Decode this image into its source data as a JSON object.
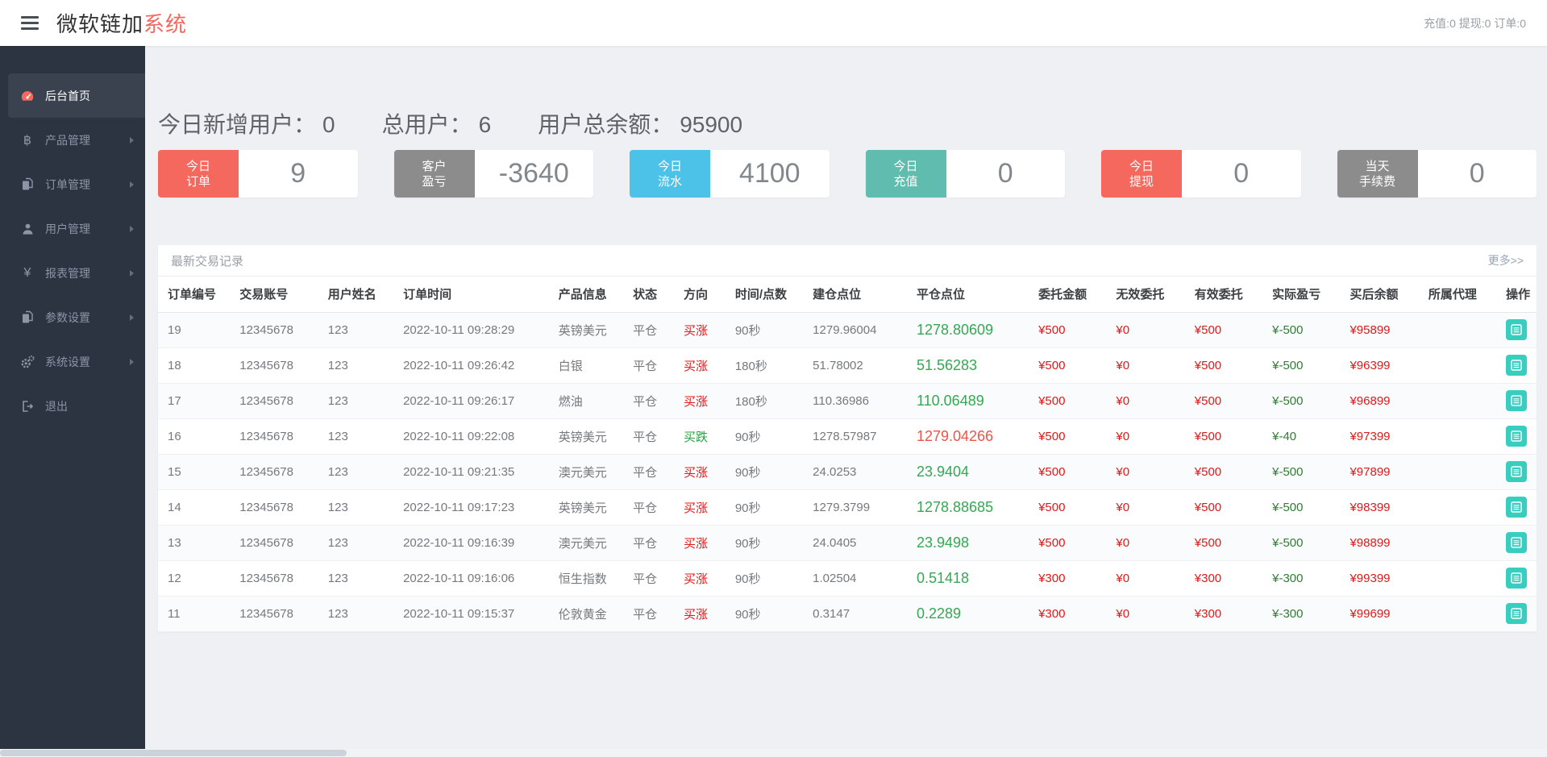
{
  "header": {
    "title_black": "微软链加",
    "title_red": "系统",
    "right_stats": "充值:0 提现:0 订单:0"
  },
  "sidebar": {
    "items": [
      {
        "key": "home",
        "label": "后台首页",
        "icon": "dashboard-icon",
        "active": true,
        "arrow": false
      },
      {
        "key": "product",
        "label": "产品管理",
        "icon": "bitcoin-icon",
        "active": false,
        "arrow": true
      },
      {
        "key": "order",
        "label": "订单管理",
        "icon": "files-icon",
        "active": false,
        "arrow": true
      },
      {
        "key": "user",
        "label": "用户管理",
        "icon": "user-icon",
        "active": false,
        "arrow": true
      },
      {
        "key": "report",
        "label": "报表管理",
        "icon": "yen-icon",
        "active": false,
        "arrow": true
      },
      {
        "key": "params",
        "label": "参数设置",
        "icon": "files-icon",
        "active": false,
        "arrow": true
      },
      {
        "key": "system",
        "label": "系统设置",
        "icon": "gears-icon",
        "active": false,
        "arrow": true
      },
      {
        "key": "logout",
        "label": "退出",
        "icon": "logout-icon",
        "active": false,
        "arrow": false
      }
    ]
  },
  "summary": {
    "items": [
      {
        "label": "今日新增用户：",
        "value": "0"
      },
      {
        "label": "总用户：",
        "value": "6"
      },
      {
        "label": "用户总余额：",
        "value": "95900"
      }
    ]
  },
  "stat_cards": [
    {
      "label_lines": [
        "今日",
        "订单"
      ],
      "value": "9",
      "color": "#f4685e"
    },
    {
      "label_lines": [
        "客户",
        "盈亏"
      ],
      "value": "-3640",
      "color": "#8c8c8c"
    },
    {
      "label_lines": [
        "今日",
        "流水"
      ],
      "value": "4100",
      "color": "#4dc2e9"
    },
    {
      "label_lines": [
        "今日",
        "充值"
      ],
      "value": "0",
      "color": "#5fbcae"
    },
    {
      "label_lines": [
        "今日",
        "提现"
      ],
      "value": "0",
      "color": "#f4685e"
    },
    {
      "label_lines": [
        "当天",
        "手续费"
      ],
      "value": "0",
      "color": "#8c8c8c"
    }
  ],
  "panel": {
    "title": "最新交易记录",
    "more_link": "更多>>",
    "columns": [
      "订单编号",
      "交易账号",
      "用户姓名",
      "订单时间",
      "产品信息",
      "状态",
      "方向",
      "时间/点数",
      "建仓点位",
      "平仓点位",
      "委托金额",
      "无效委托",
      "有效委托",
      "实际盈亏",
      "买后余额",
      "所属代理",
      "操作"
    ],
    "rows": [
      {
        "id": "19",
        "account": "12345678",
        "name": "123",
        "time": "2022-10-11 09:28:29",
        "product": "英镑美元",
        "status": "平仓",
        "direction": "买涨",
        "dir_color": "red",
        "duration": "90秒",
        "open": "1279.96004",
        "close": "1278.80609",
        "close_color": "green",
        "amount": "¥500",
        "invalid": "¥0",
        "valid": "¥500",
        "profit": "¥-500",
        "balance": "¥95899",
        "agent": ""
      },
      {
        "id": "18",
        "account": "12345678",
        "name": "123",
        "time": "2022-10-11 09:26:42",
        "product": "白银",
        "status": "平仓",
        "direction": "买涨",
        "dir_color": "red",
        "duration": "180秒",
        "open": "51.78002",
        "close": "51.56283",
        "close_color": "green",
        "amount": "¥500",
        "invalid": "¥0",
        "valid": "¥500",
        "profit": "¥-500",
        "balance": "¥96399",
        "agent": ""
      },
      {
        "id": "17",
        "account": "12345678",
        "name": "123",
        "time": "2022-10-11 09:26:17",
        "product": "燃油",
        "status": "平仓",
        "direction": "买涨",
        "dir_color": "red",
        "duration": "180秒",
        "open": "110.36986",
        "close": "110.06489",
        "close_color": "green",
        "amount": "¥500",
        "invalid": "¥0",
        "valid": "¥500",
        "profit": "¥-500",
        "balance": "¥96899",
        "agent": ""
      },
      {
        "id": "16",
        "account": "12345678",
        "name": "123",
        "time": "2022-10-11 09:22:08",
        "product": "英镑美元",
        "status": "平仓",
        "direction": "买跌",
        "dir_color": "green",
        "duration": "90秒",
        "open": "1278.57987",
        "close": "1279.04266",
        "close_color": "red",
        "amount": "¥500",
        "invalid": "¥0",
        "valid": "¥500",
        "profit": "¥-40",
        "balance": "¥97399",
        "agent": ""
      },
      {
        "id": "15",
        "account": "12345678",
        "name": "123",
        "time": "2022-10-11 09:21:35",
        "product": "澳元美元",
        "status": "平仓",
        "direction": "买涨",
        "dir_color": "red",
        "duration": "90秒",
        "open": "24.0253",
        "close": "23.9404",
        "close_color": "green",
        "amount": "¥500",
        "invalid": "¥0",
        "valid": "¥500",
        "profit": "¥-500",
        "balance": "¥97899",
        "agent": ""
      },
      {
        "id": "14",
        "account": "12345678",
        "name": "123",
        "time": "2022-10-11 09:17:23",
        "product": "英镑美元",
        "status": "平仓",
        "direction": "买涨",
        "dir_color": "red",
        "duration": "90秒",
        "open": "1279.3799",
        "close": "1278.88685",
        "close_color": "green",
        "amount": "¥500",
        "invalid": "¥0",
        "valid": "¥500",
        "profit": "¥-500",
        "balance": "¥98399",
        "agent": ""
      },
      {
        "id": "13",
        "account": "12345678",
        "name": "123",
        "time": "2022-10-11 09:16:39",
        "product": "澳元美元",
        "status": "平仓",
        "direction": "买涨",
        "dir_color": "red",
        "duration": "90秒",
        "open": "24.0405",
        "close": "23.9498",
        "close_color": "green",
        "amount": "¥500",
        "invalid": "¥0",
        "valid": "¥500",
        "profit": "¥-500",
        "balance": "¥98899",
        "agent": ""
      },
      {
        "id": "12",
        "account": "12345678",
        "name": "123",
        "time": "2022-10-11 09:16:06",
        "product": "恒生指数",
        "status": "平仓",
        "direction": "买涨",
        "dir_color": "red",
        "duration": "90秒",
        "open": "1.02504",
        "close": "0.51418",
        "close_color": "green",
        "amount": "¥300",
        "invalid": "¥0",
        "valid": "¥300",
        "profit": "¥-300",
        "balance": "¥99399",
        "agent": ""
      },
      {
        "id": "11",
        "account": "12345678",
        "name": "123",
        "time": "2022-10-11 09:15:37",
        "product": "伦敦黄金",
        "status": "平仓",
        "direction": "买涨",
        "dir_color": "red",
        "duration": "90秒",
        "open": "0.3147",
        "close": "0.2289",
        "close_color": "green",
        "amount": "¥300",
        "invalid": "¥0",
        "valid": "¥300",
        "profit": "¥-300",
        "balance": "¥99699",
        "agent": ""
      }
    ]
  }
}
